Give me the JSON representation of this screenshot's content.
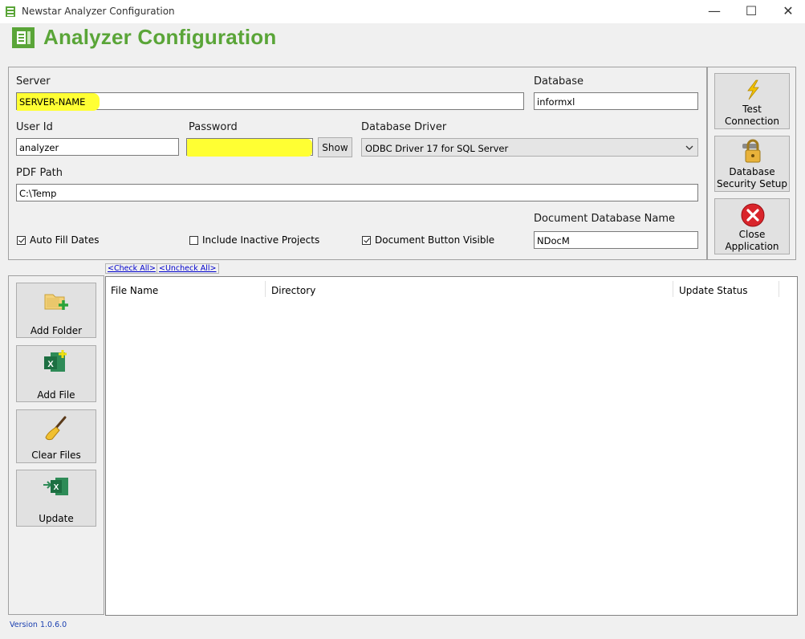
{
  "window": {
    "title": "Newstar Analyzer Configuration",
    "minimize": "—",
    "maximize": "☐",
    "close": "✕"
  },
  "header": {
    "title": "Analyzer Configuration"
  },
  "form": {
    "server_label": "Server",
    "server_value": "SERVER-NAME",
    "database_label": "Database",
    "database_value": "informxl",
    "userid_label": "User Id",
    "userid_value": "analyzer",
    "password_label": "Password",
    "password_value": "",
    "show_label": "Show",
    "driver_label": "Database Driver",
    "driver_value": "ODBC Driver 17 for SQL Server",
    "pdf_label": "PDF Path",
    "pdf_value": "C:\\Temp",
    "docdb_label": "Document Database Name",
    "docdb_value": "NDocM",
    "auto_fill_label": "Auto Fill Dates",
    "auto_fill_checked": true,
    "inactive_label": "Include Inactive Projects",
    "inactive_checked": false,
    "docbtn_label": "Document Button Visible",
    "docbtn_checked": true
  },
  "right_buttons": {
    "test_line1": "Test",
    "test_line2": "Connection",
    "security_line1": "Database",
    "security_line2": "Security Setup",
    "close_line1": "Close",
    "close_line2": "Application"
  },
  "links": {
    "check_all": "<Check All>",
    "uncheck_all": "<Uncheck All>"
  },
  "side_buttons": {
    "add_folder": "Add Folder",
    "add_file": "Add File",
    "clear_files": "Clear Files",
    "update": "Update"
  },
  "table": {
    "columns": [
      "File Name",
      "Directory",
      "Update Status"
    ]
  },
  "footer": {
    "version": "Version 1.0.6.0"
  },
  "colors": {
    "accent_green": "#5aa538",
    "highlight": "#ffff33"
  }
}
